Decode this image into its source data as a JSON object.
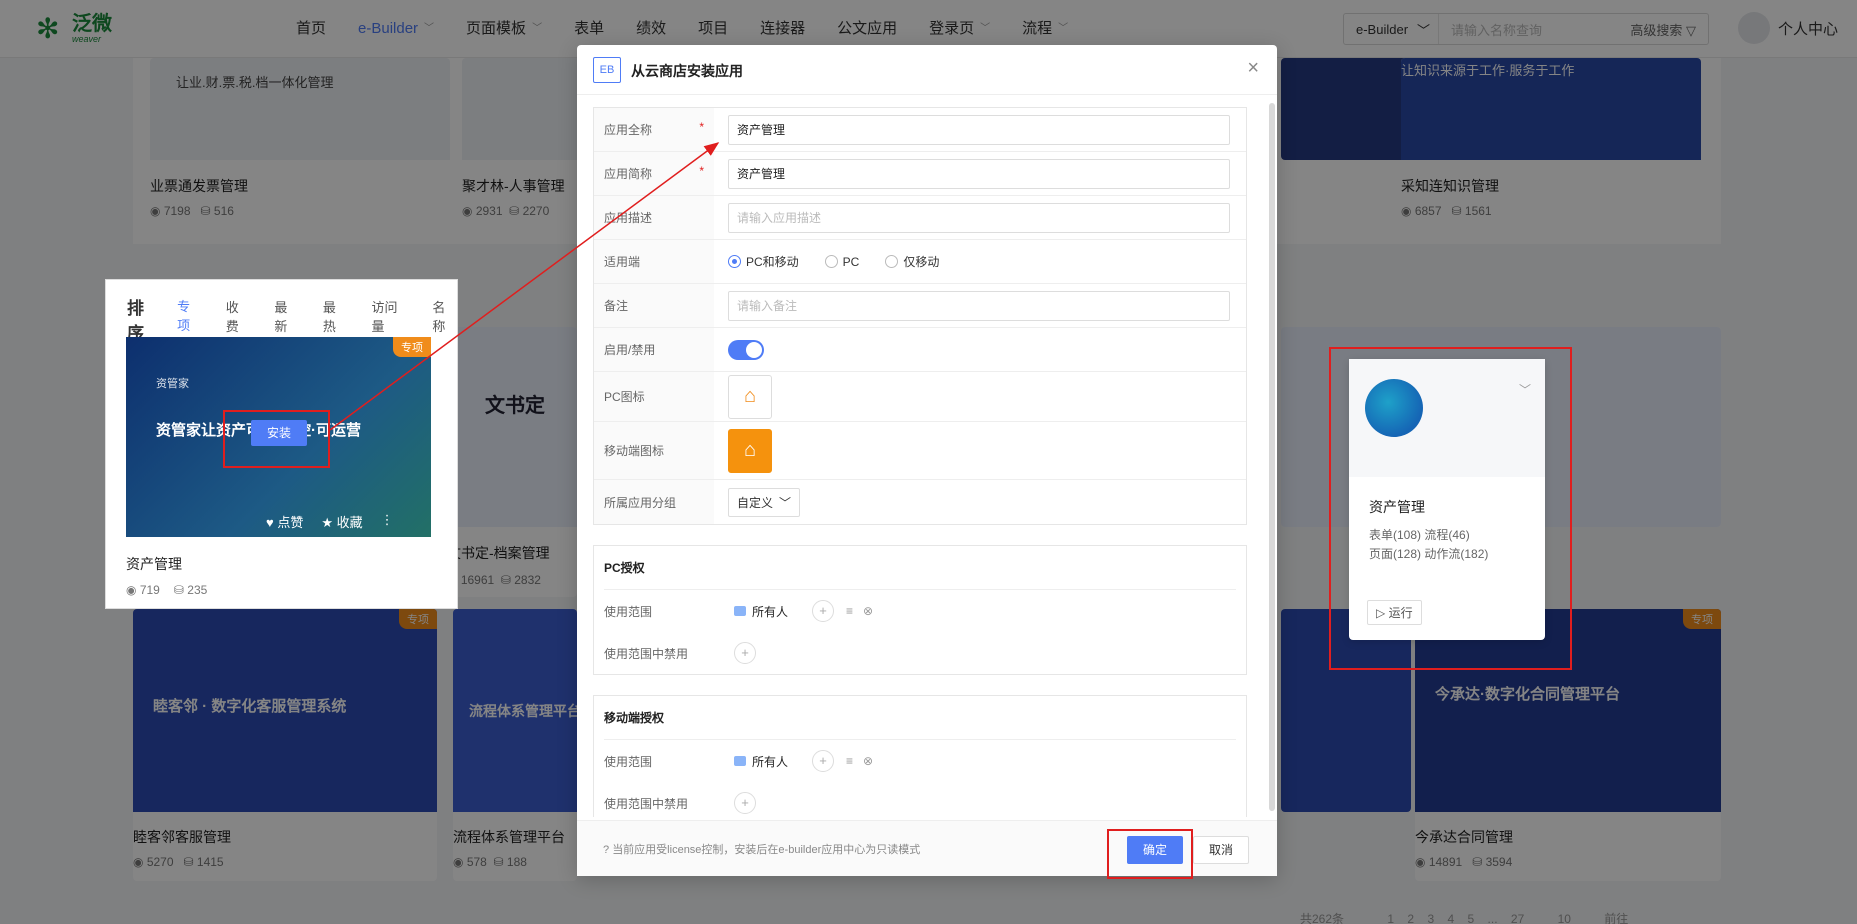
{
  "brand": {
    "name_cn": "泛微",
    "name_en": "weaver"
  },
  "nav": {
    "items": [
      {
        "label": "首页",
        "dropdown": false,
        "active": false
      },
      {
        "label": "e-Builder",
        "dropdown": true,
        "active": true
      },
      {
        "label": "页面模板",
        "dropdown": true,
        "active": false
      },
      {
        "label": "表单",
        "dropdown": false,
        "active": false
      },
      {
        "label": "绩效",
        "dropdown": false,
        "active": false
      },
      {
        "label": "项目",
        "dropdown": false,
        "active": false
      },
      {
        "label": "连接器",
        "dropdown": false,
        "active": false
      },
      {
        "label": "公文应用",
        "dropdown": false,
        "active": false
      },
      {
        "label": "登录页",
        "dropdown": true,
        "active": false
      },
      {
        "label": "流程",
        "dropdown": true,
        "active": false
      }
    ]
  },
  "search": {
    "scope": "e-Builder",
    "placeholder": "请输入名称查询",
    "advanced": "高级搜索"
  },
  "user": {
    "label": "个人中心"
  },
  "bg_cards": [
    {
      "title": "业票通发票管理",
      "views": "7198",
      "installs": "516",
      "slogan": "让业.财.票.税.档一体化管理"
    },
    {
      "title": "聚才林-人事管理",
      "views": "2931",
      "installs": "2270"
    },
    {
      "title": "采知连知识管理",
      "views": "6857",
      "installs": "1561",
      "slogan": "让知识来源于工作·服务于工作"
    },
    {
      "title": "文书定-档案管理",
      "views": "16961",
      "installs": "2832",
      "slogan": "文书定"
    },
    {
      "title": "睦客邻客服管理",
      "views": "5270",
      "installs": "1415",
      "slogan": "睦客邻 · 数字化客服管理系统",
      "tag": "专项"
    },
    {
      "title": "流程体系管理平台",
      "views": "578",
      "installs": "188",
      "slogan": "流程体系管理平台"
    },
    {
      "title": "今承达合同管理",
      "views": "14891",
      "installs": "3594",
      "slogan": "今承达·数字化合同管理平台",
      "tag": "专项"
    }
  ],
  "sort_panel": {
    "title": "排序",
    "tabs": [
      "专项",
      "收费",
      "最新",
      "最热",
      "访问量",
      "名称"
    ],
    "active_tab": "专项",
    "card": {
      "tag": "专项",
      "logo": "资管家",
      "slogan": "资管家让资产可见·可控·可运营",
      "install": "安装",
      "like": "点赞",
      "fav": "收藏",
      "name": "资产管理",
      "views": "719",
      "installs": "235"
    }
  },
  "modal": {
    "badge": "EB",
    "title": "从云商店安装应用",
    "fields": {
      "full_name_label": "应用全称",
      "full_name_value": "资产管理",
      "short_name_label": "应用简称",
      "short_name_value": "资产管理",
      "desc_label": "应用描述",
      "desc_placeholder": "请输入应用描述",
      "platform_label": "适用端",
      "platform_options": [
        "PC和移动",
        "PC",
        "仅移动"
      ],
      "platform_selected": "PC和移动",
      "remark_label": "备注",
      "remark_placeholder": "请输入备注",
      "enable_label": "启用/禁用",
      "enabled": true,
      "pc_icon_label": "PC图标",
      "mobile_icon_label": "移动端图标",
      "group_label": "所属应用分组",
      "group_value": "自定义"
    },
    "pc_auth": {
      "title": "PC授权",
      "scope_label": "使用范围",
      "scope_value": "所有人",
      "exclude_label": "使用范围中禁用"
    },
    "mobile_auth": {
      "title": "移动端授权",
      "scope_label": "使用范围",
      "scope_value": "所有人",
      "exclude_label": "使用范围中禁用"
    },
    "footer_note": "当前应用受license控制，安装后在e-builder应用中心为只读模式",
    "ok": "确定",
    "cancel": "取消"
  },
  "preview": {
    "name": "资产管理",
    "stats_line1": "表单(108) 流程(46)",
    "stats_line2": "页面(128) 动作流(182)",
    "run": "运行"
  },
  "pager": {
    "total": "共262条",
    "pages": [
      "1",
      "2",
      "3",
      "4",
      "5",
      "...",
      "27"
    ],
    "page_size": "10",
    "goto": "前往"
  },
  "colors": {
    "accent": "#4f7cf6",
    "annotation": "#e01e1e",
    "tag": "#f08c1b",
    "brand": "#1b8a3c"
  }
}
